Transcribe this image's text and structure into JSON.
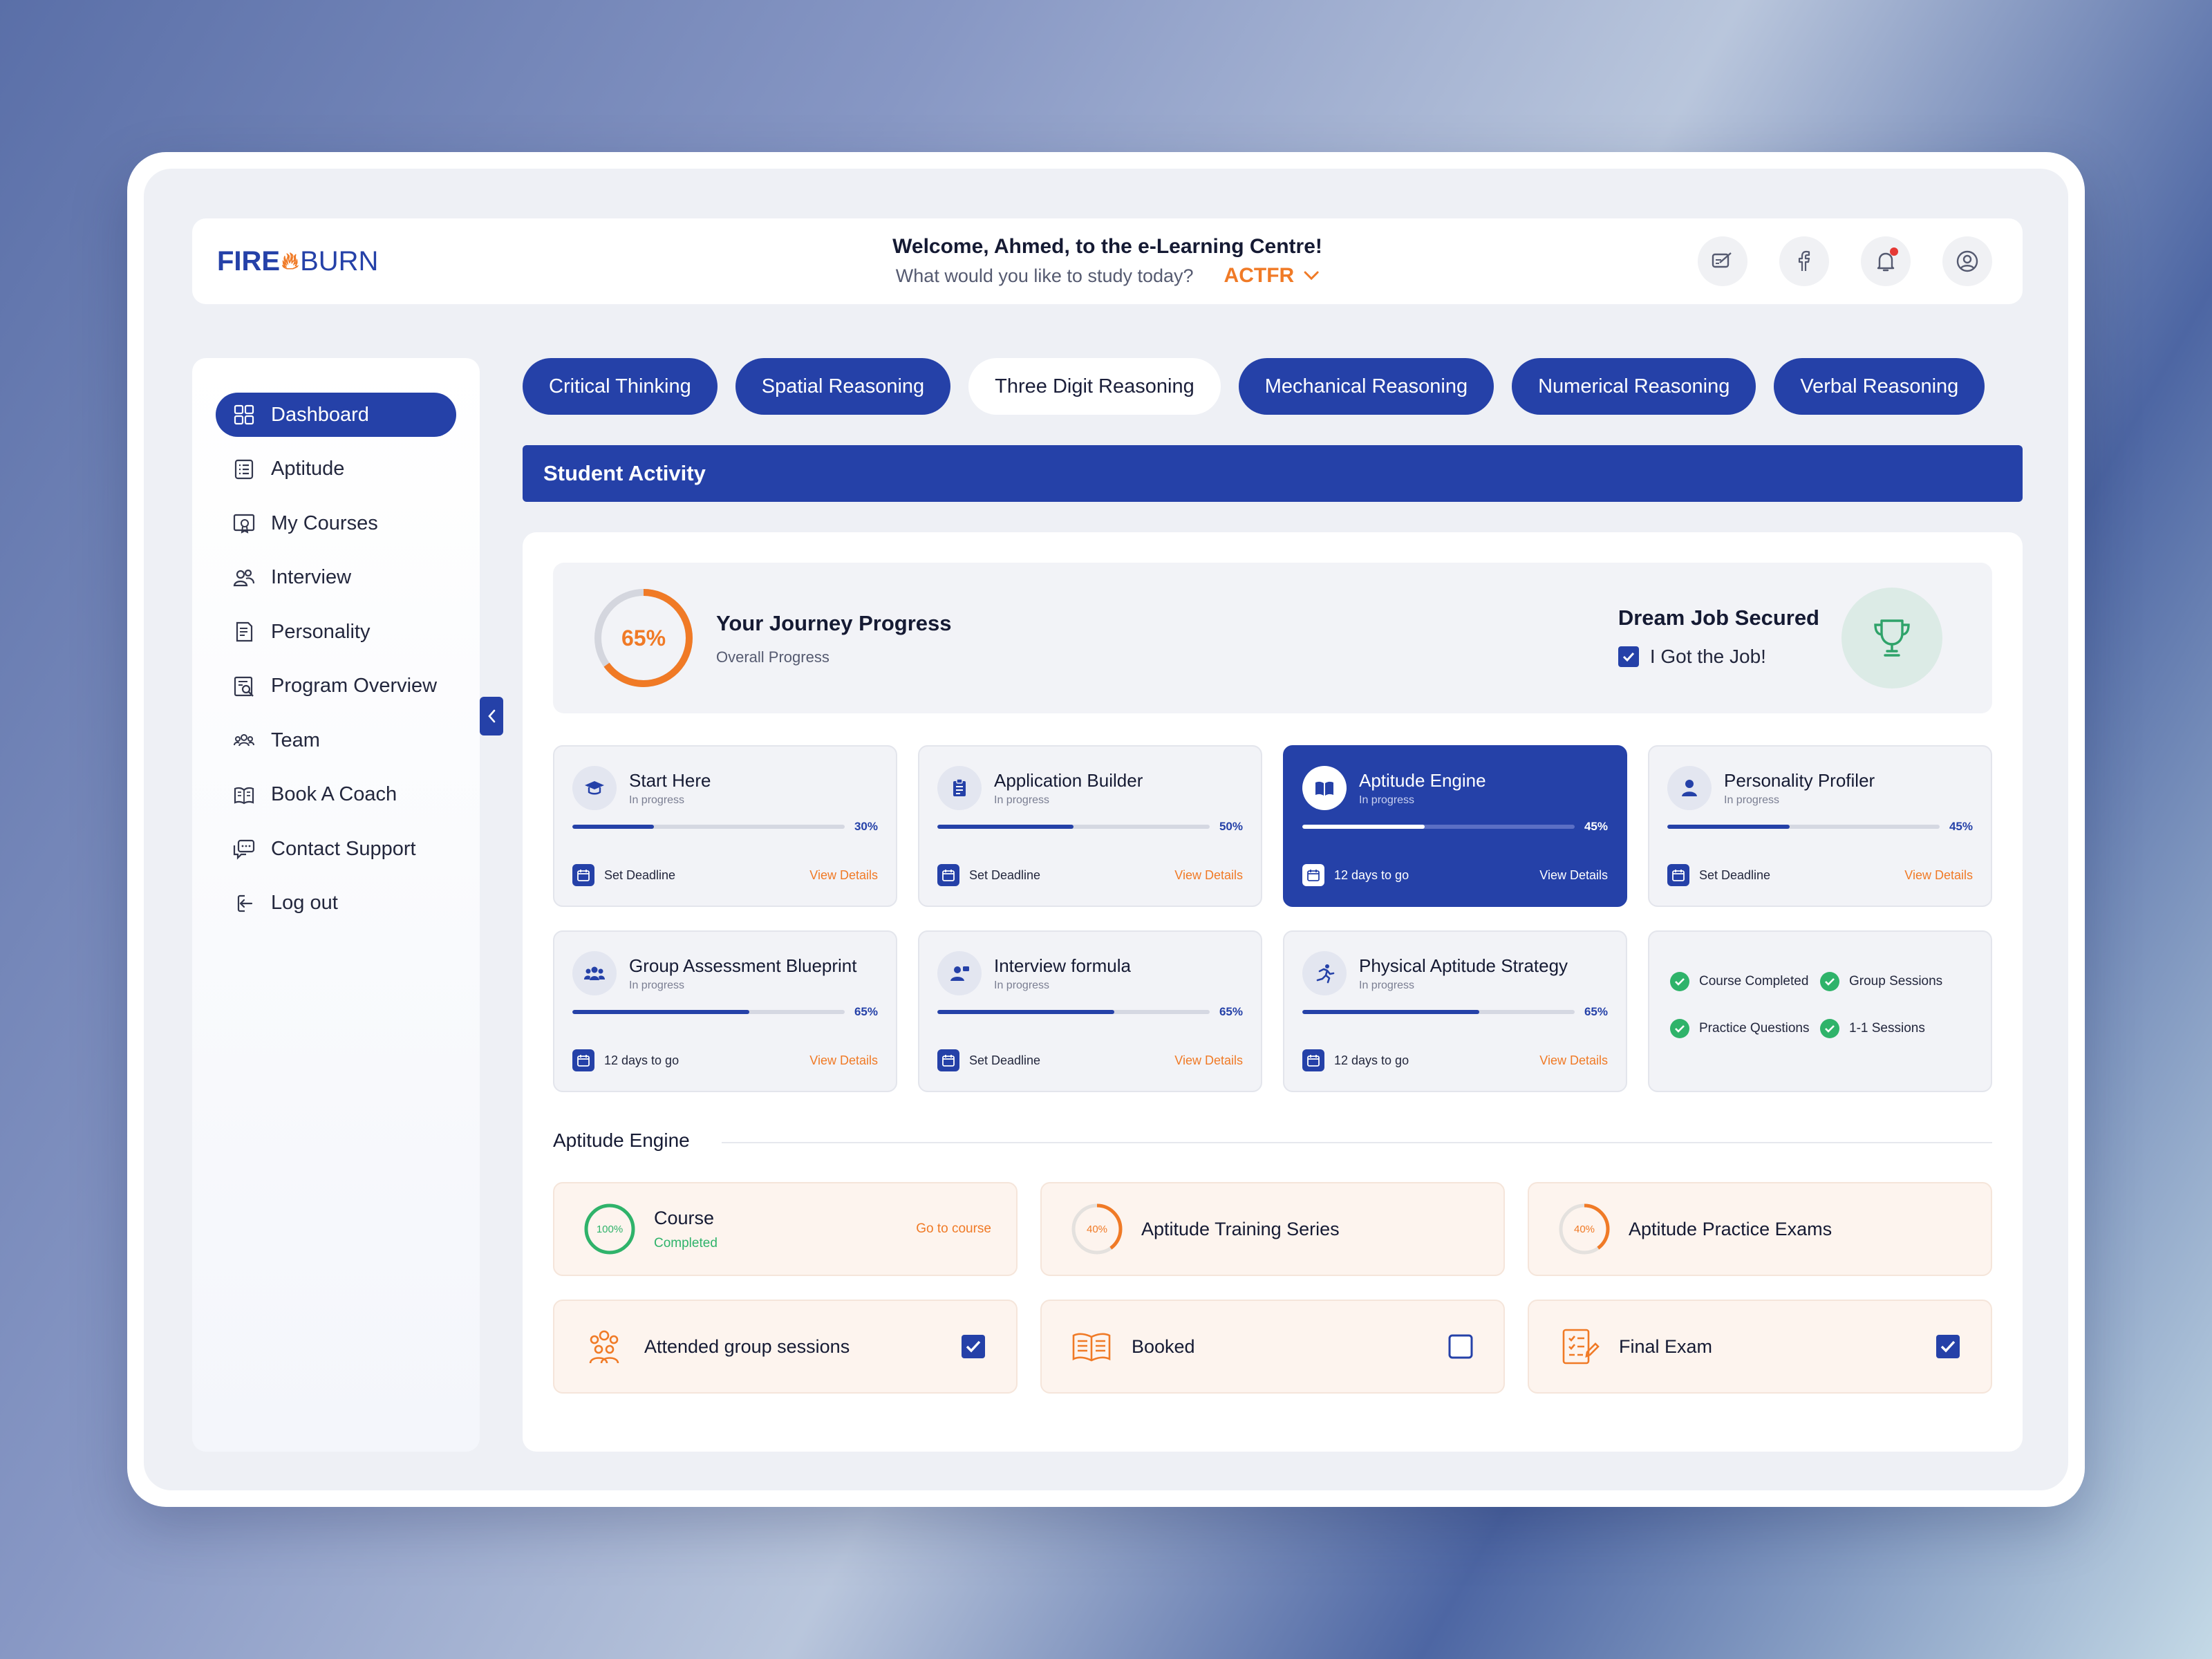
{
  "brand": {
    "part1": "FIRE",
    "part2": "BURN"
  },
  "header": {
    "welcome": "Welcome, Ahmed, to the e-Learning Centre!",
    "subtitle": "What would you like to study today?",
    "code": "ACTFR",
    "icons": [
      "edit-icon",
      "facebook-icon",
      "bell-icon",
      "user-icon"
    ]
  },
  "sidebar": {
    "items": [
      {
        "label": "Dashboard",
        "icon": "grid-icon",
        "active": true
      },
      {
        "label": "Aptitude",
        "icon": "list-icon"
      },
      {
        "label": "My Courses",
        "icon": "certificate-icon"
      },
      {
        "label": "Interview",
        "icon": "people-icon"
      },
      {
        "label": "Personality",
        "icon": "document-icon"
      },
      {
        "label": "Program Overview",
        "icon": "search-doc-icon"
      },
      {
        "label": "Team",
        "icon": "team-icon"
      },
      {
        "label": "Book A Coach",
        "icon": "book-icon"
      },
      {
        "label": "Contact Support",
        "icon": "chat-icon"
      },
      {
        "label": "Log out",
        "icon": "logout-icon"
      }
    ]
  },
  "tabs": [
    {
      "label": "Critical Thinking"
    },
    {
      "label": "Spatial Reasoning"
    },
    {
      "label": "Three Digit Reasoning",
      "selected": true
    },
    {
      "label": "Mechanical Reasoning"
    },
    {
      "label": "Numerical Reasoning"
    },
    {
      "label": "Verbal Reasoning"
    }
  ],
  "activity": {
    "title": "Student Activity",
    "journey": {
      "percent": 65,
      "percent_label": "65%",
      "title": "Your Journey Progress",
      "subtitle": "Overall Progress"
    },
    "dream": {
      "title": "Dream Job Secured",
      "check_label": "I Got the Job!",
      "checked": true
    },
    "cards": [
      {
        "title": "Start Here",
        "status": "In progress",
        "progress": 30,
        "pct_label": "30%",
        "deadline": "Set Deadline",
        "link": "View Details",
        "icon": "graduation-cap-icon"
      },
      {
        "title": "Application Builder",
        "status": "In progress",
        "progress": 50,
        "pct_label": "50%",
        "deadline": "Set Deadline",
        "link": "View Details",
        "icon": "clipboard-icon"
      },
      {
        "title": "Aptitude Engine",
        "status": "In progress",
        "progress": 45,
        "pct_label": "45%",
        "deadline": "12 days to go",
        "link": "View Details",
        "icon": "open-book-icon",
        "active": true
      },
      {
        "title": "Personality Profiler",
        "status": "In progress",
        "progress": 45,
        "pct_label": "45%",
        "deadline": "Set Deadline",
        "link": "View Details",
        "icon": "person-icon"
      },
      {
        "title": "Group Assessment Blueprint",
        "status": "In progress",
        "progress": 65,
        "pct_label": "65%",
        "deadline": "12 days to go",
        "link": "View Details",
        "icon": "group-icon"
      },
      {
        "title": "Interview formula",
        "status": "In progress",
        "progress": 65,
        "pct_label": "65%",
        "deadline": "Set Deadline",
        "link": "View Details",
        "icon": "interview-icon"
      },
      {
        "title": "Physical Aptitude Strategy",
        "status": "In progress",
        "progress": 65,
        "pct_label": "65%",
        "deadline": "12 days to go",
        "link": "View Details",
        "icon": "running-icon"
      }
    ],
    "checklist": [
      "Course Completed",
      "Group Sessions",
      "Practice Questions",
      "1-1 Sessions"
    ]
  },
  "aptitude_engine": {
    "title": "Aptitude Engine",
    "tiles": [
      {
        "kind": "ring",
        "percent": 100,
        "pct_label": "100%",
        "color": "#2fb36a",
        "title": "Course",
        "sub": "Completed",
        "link": "Go to course"
      },
      {
        "kind": "ring",
        "percent": 40,
        "pct_label": "40%",
        "color": "#f07a26",
        "title": "Aptitude Training Series"
      },
      {
        "kind": "ring",
        "percent": 40,
        "pct_label": "40%",
        "color": "#f07a26",
        "title": "Aptitude Practice Exams"
      },
      {
        "kind": "check",
        "icon": "group-sessions-icon",
        "title": "Attended group sessions",
        "checked": true
      },
      {
        "kind": "check",
        "icon": "books-icon",
        "title": "Booked",
        "checked": false
      },
      {
        "kind": "check",
        "icon": "exam-icon",
        "title": "Final Exam",
        "checked": true
      }
    ]
  },
  "colors": {
    "primary": "#2541a8",
    "accent": "#f07a26",
    "success": "#2fb36a"
  }
}
